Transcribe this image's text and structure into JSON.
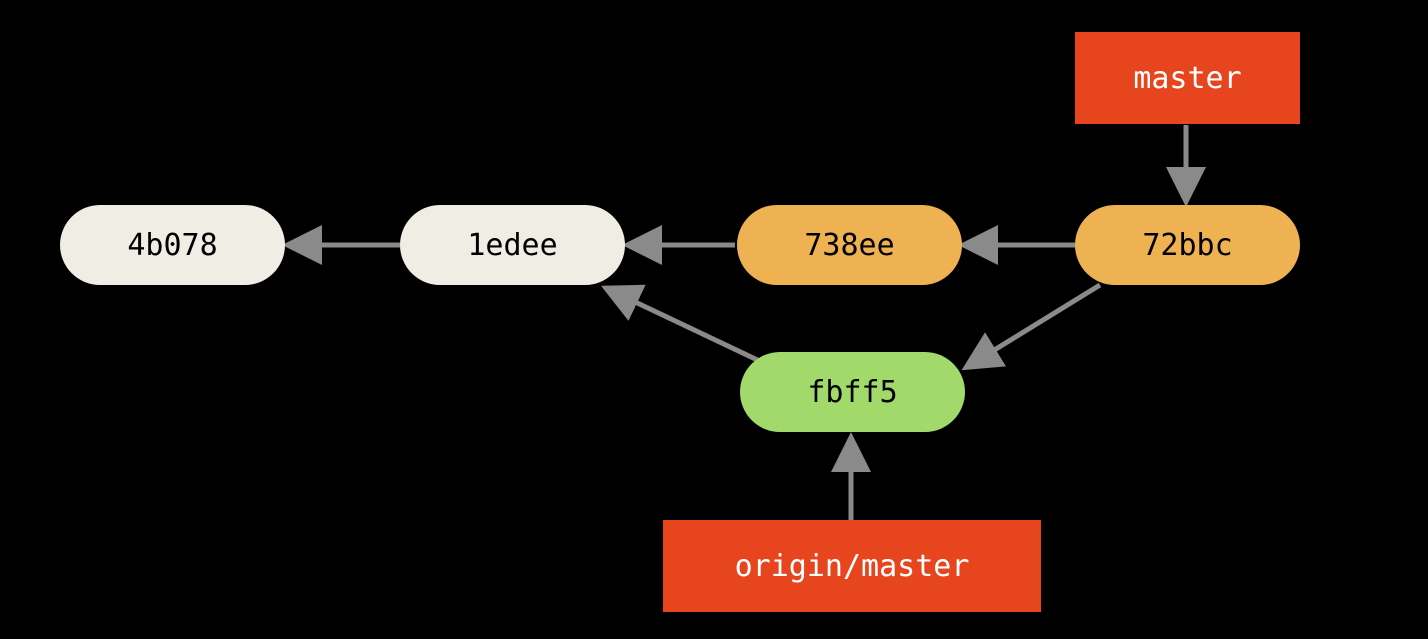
{
  "nodes": {
    "commit1": "4b078",
    "commit2": "1edee",
    "commit3": "738ee",
    "commit4": "72bbc",
    "commit5": "fbff5"
  },
  "branches": {
    "master": "master",
    "origin_master": "origin/master"
  },
  "colors": {
    "commit_gray": "#efede4",
    "commit_orange": "#efb252",
    "commit_green": "#a2d96b",
    "branch_red": "#e6451e",
    "bg": "#000000",
    "arrow": "#8a8a8a"
  },
  "diagram": {
    "description": "Git commit graph. master points to 72bbc. 72bbc -> 738ee -> 1edee -> 4b078. 72bbc also -> fbff5 -> 1edee. origin/master points to fbff5."
  }
}
